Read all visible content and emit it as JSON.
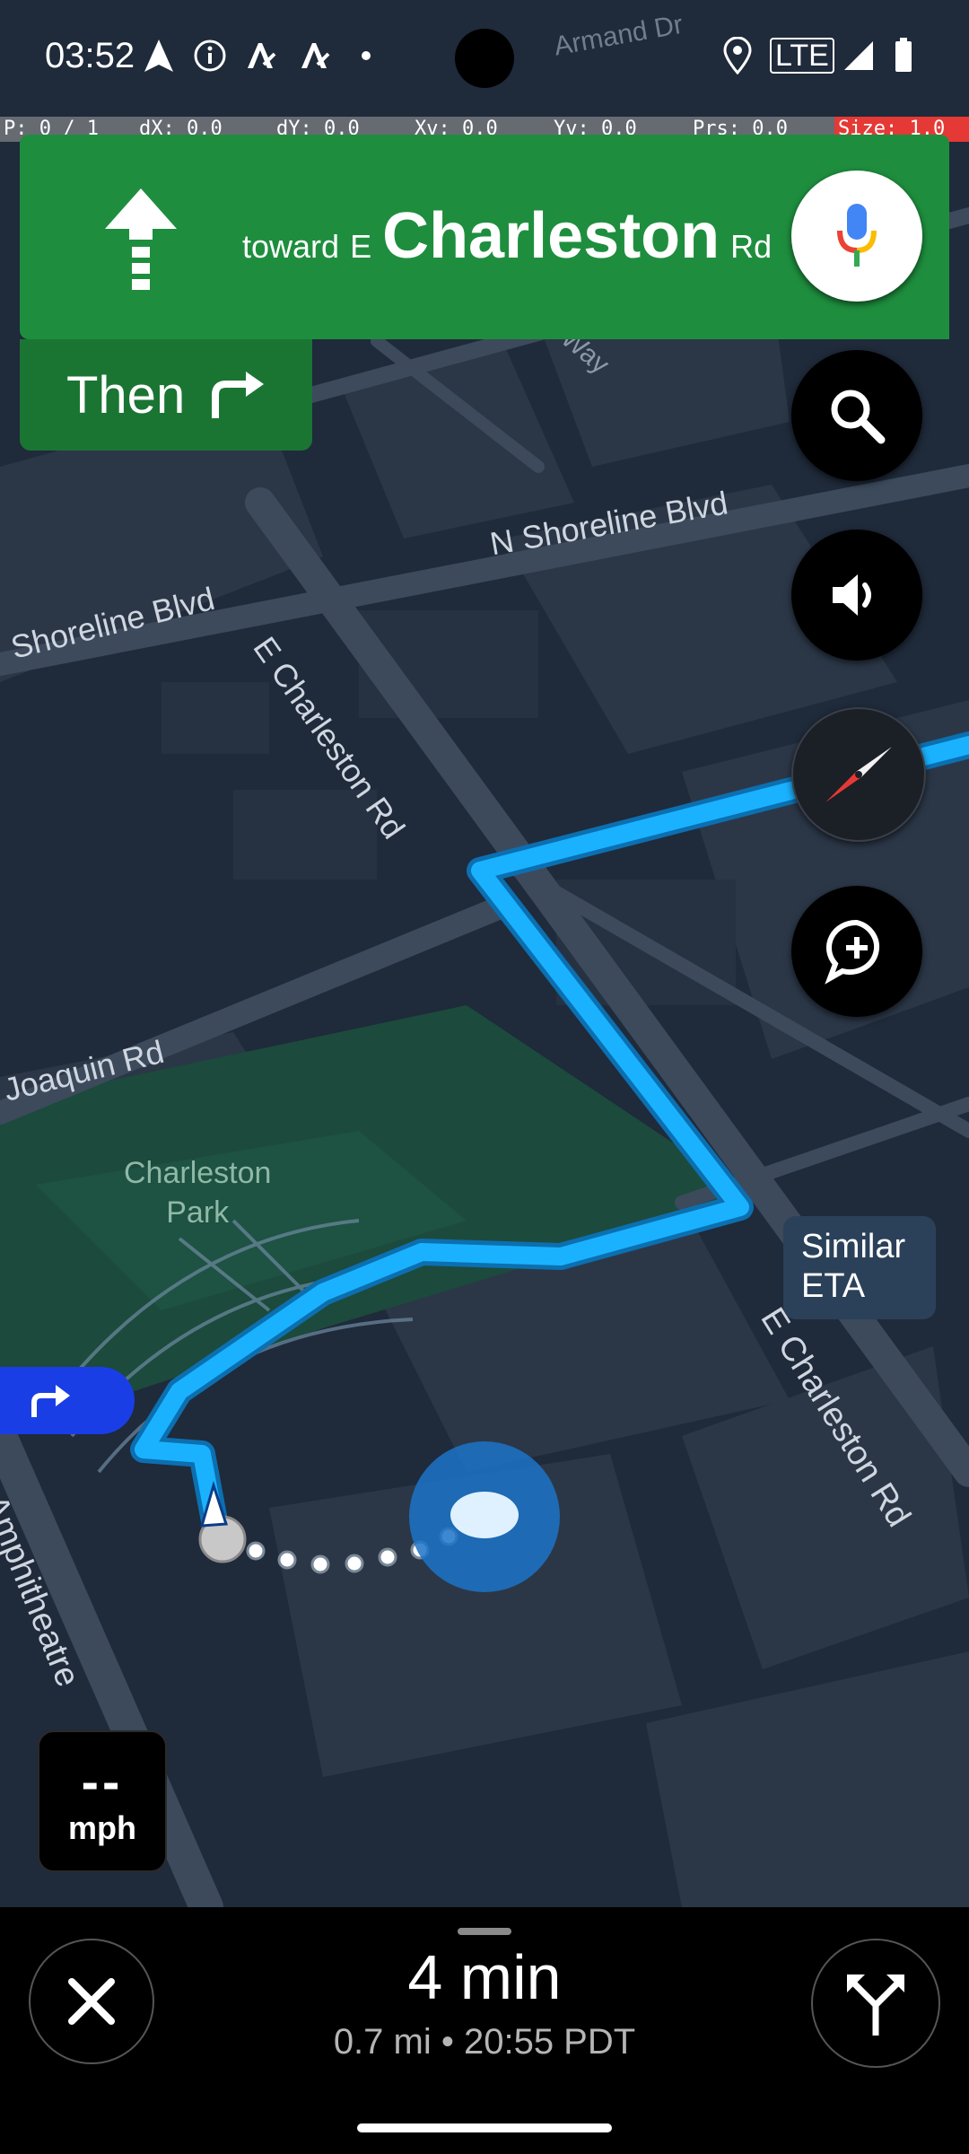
{
  "status_bar": {
    "time": "03:52",
    "network": "LTE"
  },
  "debug_overlay": {
    "pointer": "P: 0 / 1",
    "dx": "dX: 0.0",
    "dy": "dY: 0.0",
    "xv": "Xv: 0.0",
    "yv": "Yv: 0.0",
    "prs": "Prs: 0.0",
    "size": "Size: 1.0"
  },
  "navigation": {
    "toward": "toward",
    "direction_prefix": "E",
    "street": "Charleston",
    "street_suffix": "Rd",
    "then_label": "Then"
  },
  "map_labels": {
    "n_shoreline": "N Shoreline Blvd",
    "shoreline": "Shoreline Blvd",
    "e_charleston_upper": "E Charleston Rd",
    "e_charleston_lower": "E Charleston Rd",
    "joaquin": "Joaquin Rd",
    "park_line1": "Charleston",
    "park_line2": "Park",
    "amphitheatre": "Amphitheatre",
    "way": "Way",
    "armand": "Armand Dr"
  },
  "eta_chip": {
    "line1": "Similar",
    "line2": "ETA"
  },
  "speed": {
    "value": "--",
    "unit": "mph"
  },
  "trip": {
    "duration": "4 min",
    "details": "0.7 mi  •  20:55 PDT"
  },
  "colors": {
    "nav_green": "#1e8e3e",
    "route_blue": "#1ab2ff",
    "map_bg": "#1f2a3a",
    "park_green": "#1c4a3c"
  }
}
